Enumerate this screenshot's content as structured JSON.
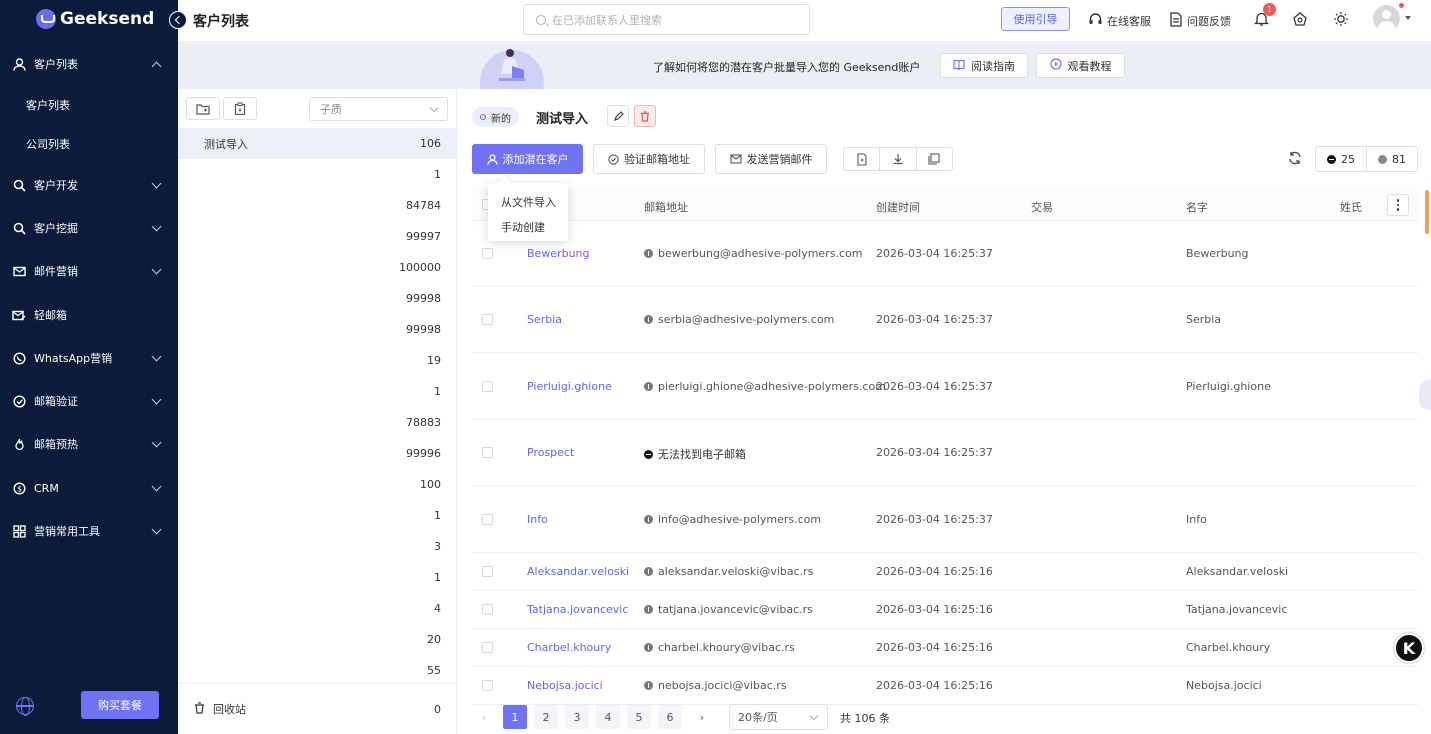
{
  "app": {
    "brand": "Geeksend",
    "page_title": "客户列表"
  },
  "search": {
    "placeholder": "在已添加联系人里搜索"
  },
  "topbar": {
    "guide_label": "使用引导",
    "service_label": "在线客服",
    "feedback_label": "问题反馈",
    "notification_count": "1"
  },
  "sidebar": {
    "items": [
      {
        "label": "客户列表",
        "icon": "user-icon",
        "expanded": true
      },
      {
        "label": "客户列表",
        "sub": true
      },
      {
        "label": "公司列表",
        "sub": true
      },
      {
        "label": "客户开发",
        "icon": "search-icon"
      },
      {
        "label": "客户挖掘",
        "icon": "search-icon"
      },
      {
        "label": "邮件营销",
        "icon": "mail-icon"
      },
      {
        "label": "轻邮箱",
        "icon": "mail-edit-icon"
      },
      {
        "label": "WhatsApp营销",
        "icon": "whatsapp-icon"
      },
      {
        "label": "邮箱验证",
        "icon": "check-circle-icon"
      },
      {
        "label": "邮箱预热",
        "icon": "flame-icon"
      },
      {
        "label": "CRM",
        "icon": "dollar-icon"
      },
      {
        "label": "营销常用工具",
        "icon": "grid-icon"
      }
    ],
    "buy_label": "购买套餐"
  },
  "banner": {
    "text": "了解如何将您的潜在客户批量导入您的 Geeksend账户",
    "read_guide": "阅读指南",
    "watch_tutorial": "观看教程"
  },
  "list_panel": {
    "filter_value": "子质",
    "rows": [
      {
        "name": "测试导入",
        "count": "106"
      },
      {
        "name": "",
        "count": "1"
      },
      {
        "name": "",
        "count": "84784"
      },
      {
        "name": "",
        "count": "99997"
      },
      {
        "name": "",
        "count": "100000"
      },
      {
        "name": "",
        "count": "99998"
      },
      {
        "name": "",
        "count": "99998"
      },
      {
        "name": "",
        "count": "19"
      },
      {
        "name": "",
        "count": "1"
      },
      {
        "name": "",
        "count": "78883"
      },
      {
        "name": "",
        "count": "99996"
      },
      {
        "name": "",
        "count": "100"
      },
      {
        "name": "",
        "count": "1"
      },
      {
        "name": "",
        "count": "3"
      },
      {
        "name": "",
        "count": "1"
      },
      {
        "name": "",
        "count": "4"
      },
      {
        "name": "",
        "count": "20"
      },
      {
        "name": "",
        "count": "55"
      }
    ],
    "recycle_label": "回收站",
    "recycle_count": "0"
  },
  "main": {
    "tag_new": "新的",
    "list_title": "测试导入",
    "add_prospect": "添加潜在客户",
    "verify_email": "验证邮箱地址",
    "send_marketing": "发送营销邮件",
    "stat_a": "25",
    "stat_b": "81",
    "dropdown": {
      "from_file": "从文件导入",
      "manual": "手动创建"
    },
    "columns": {
      "name": "名字",
      "email": "邮箱地址",
      "created": "创建时间",
      "deal": "交易",
      "first_name": "名字",
      "last_name": "姓氏"
    },
    "rows": [
      {
        "name": "Bewerbung",
        "email": "bewerbung@adhesive-polymers.com",
        "created": "2026-03-04 16:25:37",
        "first_name": "Bewerbung",
        "found": true
      },
      {
        "name": "Serbia",
        "email": "serbia@adhesive-polymers.com",
        "created": "2026-03-04 16:25:37",
        "first_name": "Serbia",
        "found": true
      },
      {
        "name": "Pierluigi.ghione",
        "email": "pierluigi.ghione@adhesive-polymers.com",
        "created": "2026-03-04 16:25:37",
        "first_name": "Pierluigi.ghione",
        "found": true
      },
      {
        "name": "Prospect",
        "email": "无法找到电子邮箱",
        "created": "2026-03-04 16:25:37",
        "first_name": "",
        "found": false
      },
      {
        "name": "Info",
        "email": "info@adhesive-polymers.com",
        "created": "2026-03-04 16:25:37",
        "first_name": "Info",
        "found": true
      },
      {
        "name": "Aleksandar.veloski",
        "email": "aleksandar.veloski@vibac.rs",
        "created": "2026-03-04 16:25:16",
        "first_name": "Aleksandar.veloski",
        "found": true
      },
      {
        "name": "Tatjana.jovancevic",
        "email": "tatjana.jovancevic@vibac.rs",
        "created": "2026-03-04 16:25:16",
        "first_name": "Tatjana.jovancevic",
        "found": true
      },
      {
        "name": "Charbel.khoury",
        "email": "charbel.khoury@vibac.rs",
        "created": "2026-03-04 16:25:16",
        "first_name": "Charbel.khoury",
        "found": true
      },
      {
        "name": "Nebojsa.jocici",
        "email": "nebojsa.jocici@vibac.rs",
        "created": "2026-03-04 16:25:16",
        "first_name": "Nebojsa.jocici",
        "found": true
      }
    ],
    "pagination": {
      "pages": [
        "1",
        "2",
        "3",
        "4",
        "5",
        "6"
      ],
      "current": "1",
      "page_size": "20条/页",
      "total": "共 106 条"
    }
  },
  "colors": {
    "accent": "#6f73f5",
    "sidebar_bg": "#0d1b3a"
  }
}
